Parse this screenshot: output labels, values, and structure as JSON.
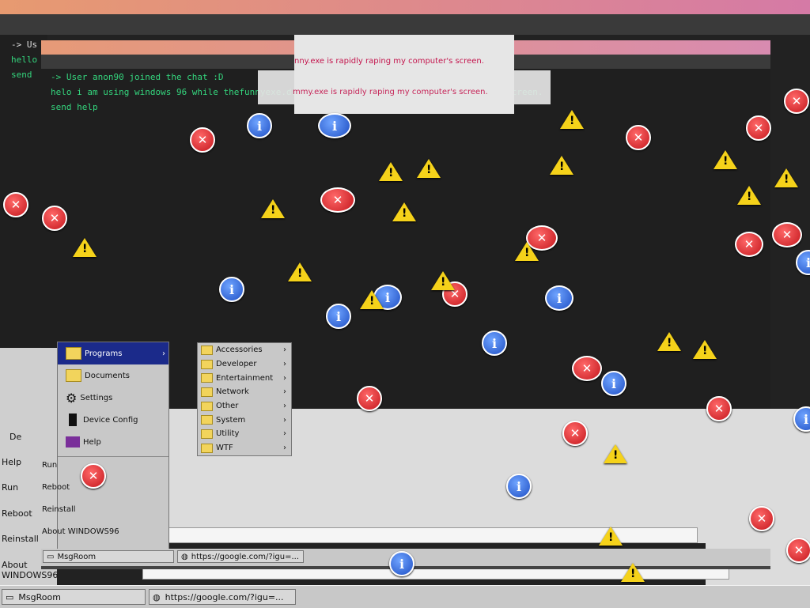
{
  "chat_back": {
    "lines": [
      "-> Us",
      "hello",
      "send"
    ]
  },
  "chat_main": {
    "lines": [
      "-> User anon90 joined the chat :D",
      "helo i am using windows 96 while thefunnyexe.dummy.exe is rapidly raping my computer's screen.",
      "send help"
    ]
  },
  "dialogs": {
    "top_text": "nny.exe is rapidly raping my computer's screen.",
    "mid_text": "mmy.exe is rapidly raping my computer's screen."
  },
  "start_menu": {
    "items": [
      "Programs",
      "Documents",
      "Settings",
      "Device Config",
      "Help"
    ],
    "lower_items": [
      "Run",
      "Reboot",
      "Reinstall",
      "About WINDOWS96"
    ]
  },
  "programs_submenu": {
    "items": [
      "Accessories",
      "Developer",
      "Entertainment",
      "Network",
      "Other",
      "System",
      "Utility",
      "WTF"
    ]
  },
  "ghost_menu": {
    "items": [
      "De",
      "Help",
      "Run",
      "Reboot",
      "Reinstall",
      "About WINDOWS96"
    ]
  },
  "taskbar_upper": {
    "buttons": [
      "MsgRoom",
      "https://google.com/?igu=..."
    ]
  },
  "taskbar": {
    "buttons": [
      "MsgRoom",
      "https://google.com/?igu=..."
    ]
  },
  "colors": {
    "chat_text": "#34d57d",
    "dialog_text": "#c4154d",
    "titlebar": "#e69a77"
  },
  "icons": {
    "error": "error-icon",
    "info": "info-icon",
    "warning": "warning-icon"
  }
}
